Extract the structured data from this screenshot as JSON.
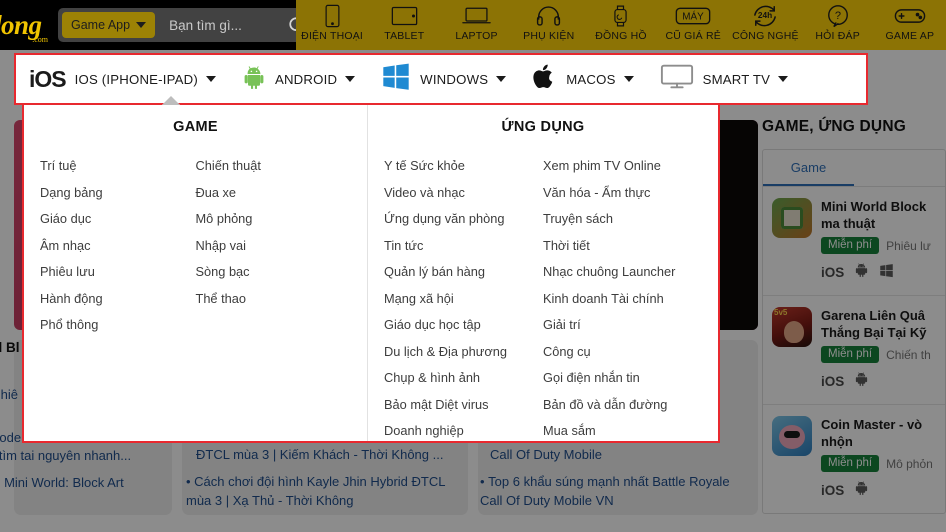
{
  "site": {
    "logo_text": "dong",
    "logo_suffix": ".com"
  },
  "search": {
    "category_label": "Game App",
    "placeholder": "Bạn tìm gì...",
    "value": ""
  },
  "category_nav": [
    {
      "label": "ĐIỆN THOẠI",
      "icon": "phone-icon"
    },
    {
      "label": "TABLET",
      "icon": "tablet-icon"
    },
    {
      "label": "LAPTOP",
      "icon": "laptop-icon"
    },
    {
      "label": "PHỤ KIỆN",
      "icon": "headphone-icon"
    },
    {
      "label": "ĐỒNG HỒ",
      "icon": "watch-icon"
    },
    {
      "label": "CŨ GIÁ RẺ",
      "icon": "may-badge-icon"
    },
    {
      "label": "CÔNG NGHỆ",
      "icon": "24h-refresh-icon"
    },
    {
      "label": "HỎI ĐÁP",
      "icon": "question-bubble-icon"
    },
    {
      "label": "GAME AP",
      "icon": "gamepad-icon"
    }
  ],
  "platform_bar": {
    "items": [
      {
        "label": "IOS (IPHONE-IPAD)",
        "icon": "ios-logo-icon",
        "has_caret": true,
        "active": true
      },
      {
        "label": "ANDROID",
        "icon": "android-robot-icon",
        "has_caret": true,
        "active": false
      },
      {
        "label": "WINDOWS",
        "icon": "windows-logo-icon",
        "has_caret": true,
        "active": false
      },
      {
        "label": "MACOS",
        "icon": "apple-logo-icon",
        "has_caret": true,
        "active": false
      },
      {
        "label": "SMART TV",
        "icon": "tv-monitor-icon",
        "has_caret": true,
        "active": false
      }
    ]
  },
  "mega_menu": {
    "game": {
      "title": "GAME",
      "items": [
        "Trí tuệ",
        "Chiến thuật",
        "Dạng bảng",
        "Đua xe",
        "Giáo dục",
        "Mô phỏng",
        "Âm nhạc",
        "Nhập vai",
        "Phiêu lưu",
        "Sòng bạc",
        "Hành động",
        "Thể thao",
        "Phổ thông",
        ""
      ]
    },
    "apps": {
      "title": "ỨNG DỤNG",
      "items": [
        "Y tế Sức khỏe",
        "Xem phim TV Online",
        "Video và nhạc",
        "Văn hóa - Ẩm thực",
        "Ứng dụng văn phòng",
        "Truyện sách",
        "Tin tức",
        "Thời tiết",
        "Quản lý bán hàng",
        "Nhạc chuông Launcher",
        "Mạng xã hội",
        "Kinh doanh Tài chính",
        "Giáo dục học tập",
        "Giải trí",
        "Du lịch & Địa phương",
        "Công cụ",
        "Chụp & hình ảnh",
        "Gọi điện nhắn tin",
        "Bảo mật Diệt virus",
        "Bản đồ và dẫn đường",
        "Doanh nghiệp",
        "Mua sắm"
      ]
    }
  },
  "sidebar": {
    "title": "GAME, ỨNG DỤNG",
    "tabs": [
      {
        "label": "Game",
        "active": true
      }
    ],
    "items": [
      {
        "name": "Mini World Block",
        "name_line2": "ma thuật",
        "price_badge": "Miễn phí",
        "genre": "Phiêu lư",
        "platforms": [
          "iOS",
          "android-icon",
          "windows-icon"
        ],
        "thumb": "t1"
      },
      {
        "name": "Garena Liên Quâ",
        "name_line2": "Thắng Bại Tại Kỹ",
        "price_badge": "Miễn phí",
        "genre": "Chiến th",
        "platforms": [
          "iOS",
          "android-icon"
        ],
        "thumb": "t2"
      },
      {
        "name": "Coin Master - vò",
        "name_line2": "nhộn",
        "price_badge": "Miễn phí",
        "genre": "Mô phỏn",
        "platforms": [
          "iOS",
          "android-icon"
        ],
        "thumb": "t3"
      }
    ]
  },
  "background_articles": {
    "col1": {
      "heading": "d Bl",
      "lines": [
        "Phiê",
        "Code",
        "ể tìm tai nguyên nhanh...",
        "ản Mini World: Block Art"
      ]
    },
    "col2": {
      "lines": [
        "ĐTCL mùa 3 | Kiếm Khách - Thời Không ...",
        "Cách chơi đội hình Kayle Jhin Hybrid ĐTCL mùa 3 | Xạ Thủ - Thời Không"
      ]
    },
    "col3": {
      "lines": [
        "Call Of Duty Mobile",
        "Top 6 khẩu súng mạnh nhất Battle Royale Call Of Duty Mobile VN"
      ]
    }
  },
  "colors": {
    "brand_yellow": "#f0c400",
    "nav_olive": "#8c7305",
    "accent_red": "#e8292f",
    "free_green": "#17823b",
    "link_blue": "#1f4e8c",
    "tab_blue": "#2f6fb8"
  }
}
